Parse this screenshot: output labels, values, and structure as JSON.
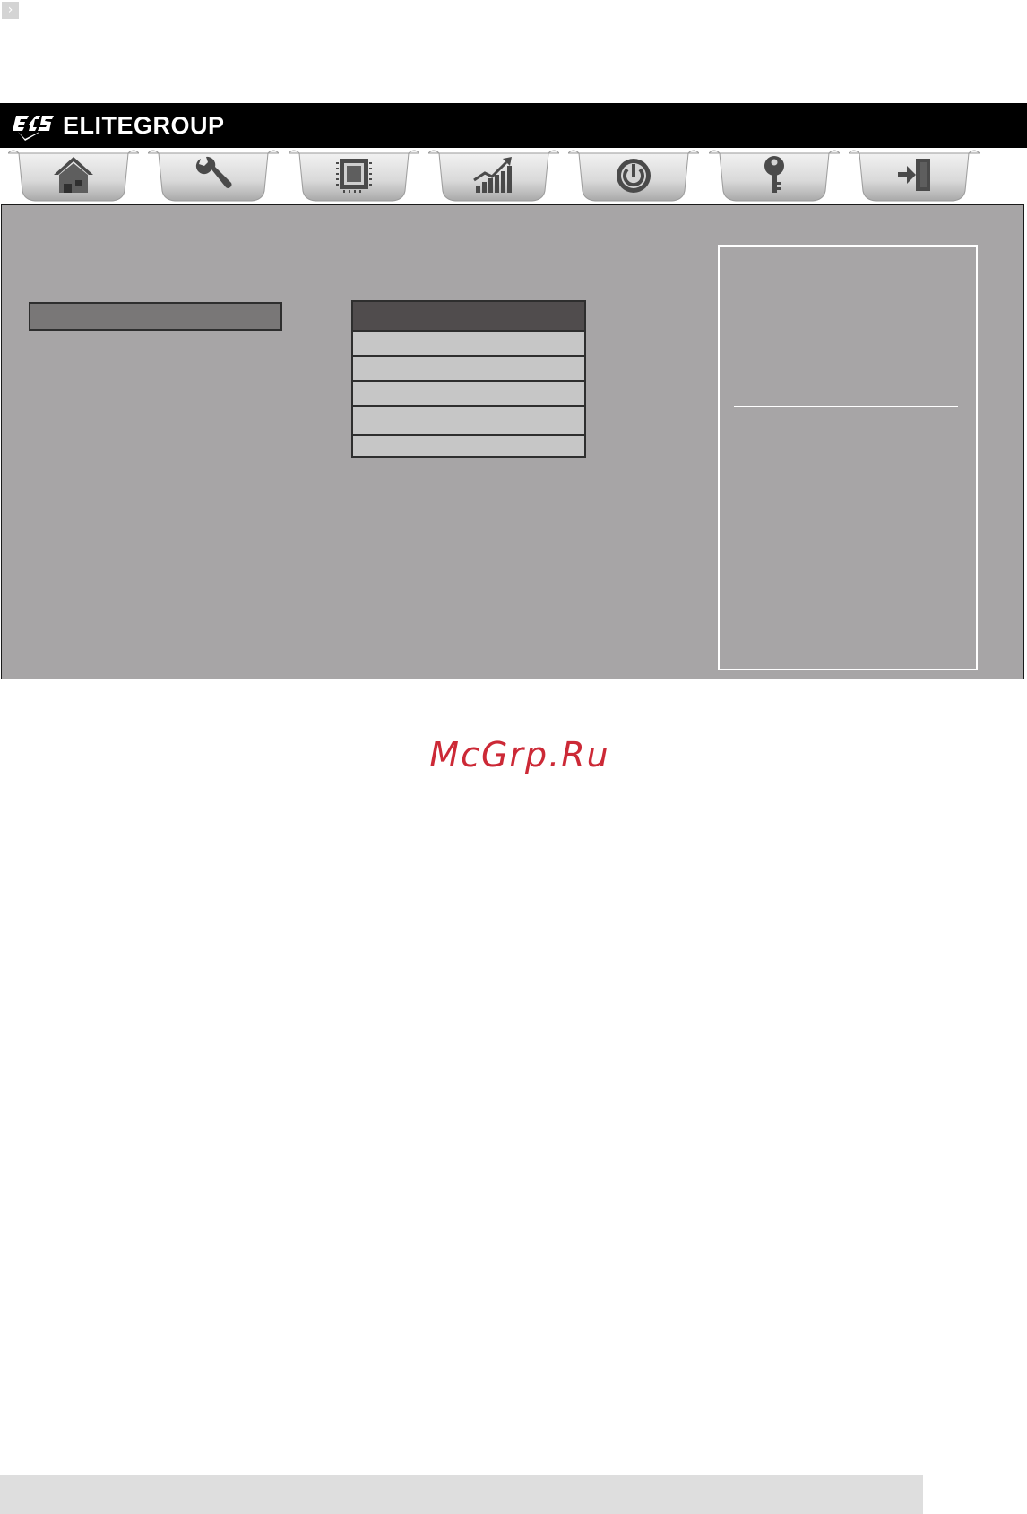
{
  "brand": {
    "logo_text": "ECS",
    "name": "ELITEGROUP",
    "bar_color": "#000000"
  },
  "nav": {
    "tabs": [
      {
        "icon": "home-icon"
      },
      {
        "icon": "wrench-icon"
      },
      {
        "icon": "chip-icon"
      },
      {
        "icon": "chart-icon"
      },
      {
        "icon": "power-icon"
      },
      {
        "icon": "key-icon"
      },
      {
        "icon": "exit-icon"
      }
    ]
  },
  "panel": {
    "background": "#a7a5a6"
  },
  "watermark": {
    "text": "McGrp.Ru",
    "color": "#cc2936"
  }
}
